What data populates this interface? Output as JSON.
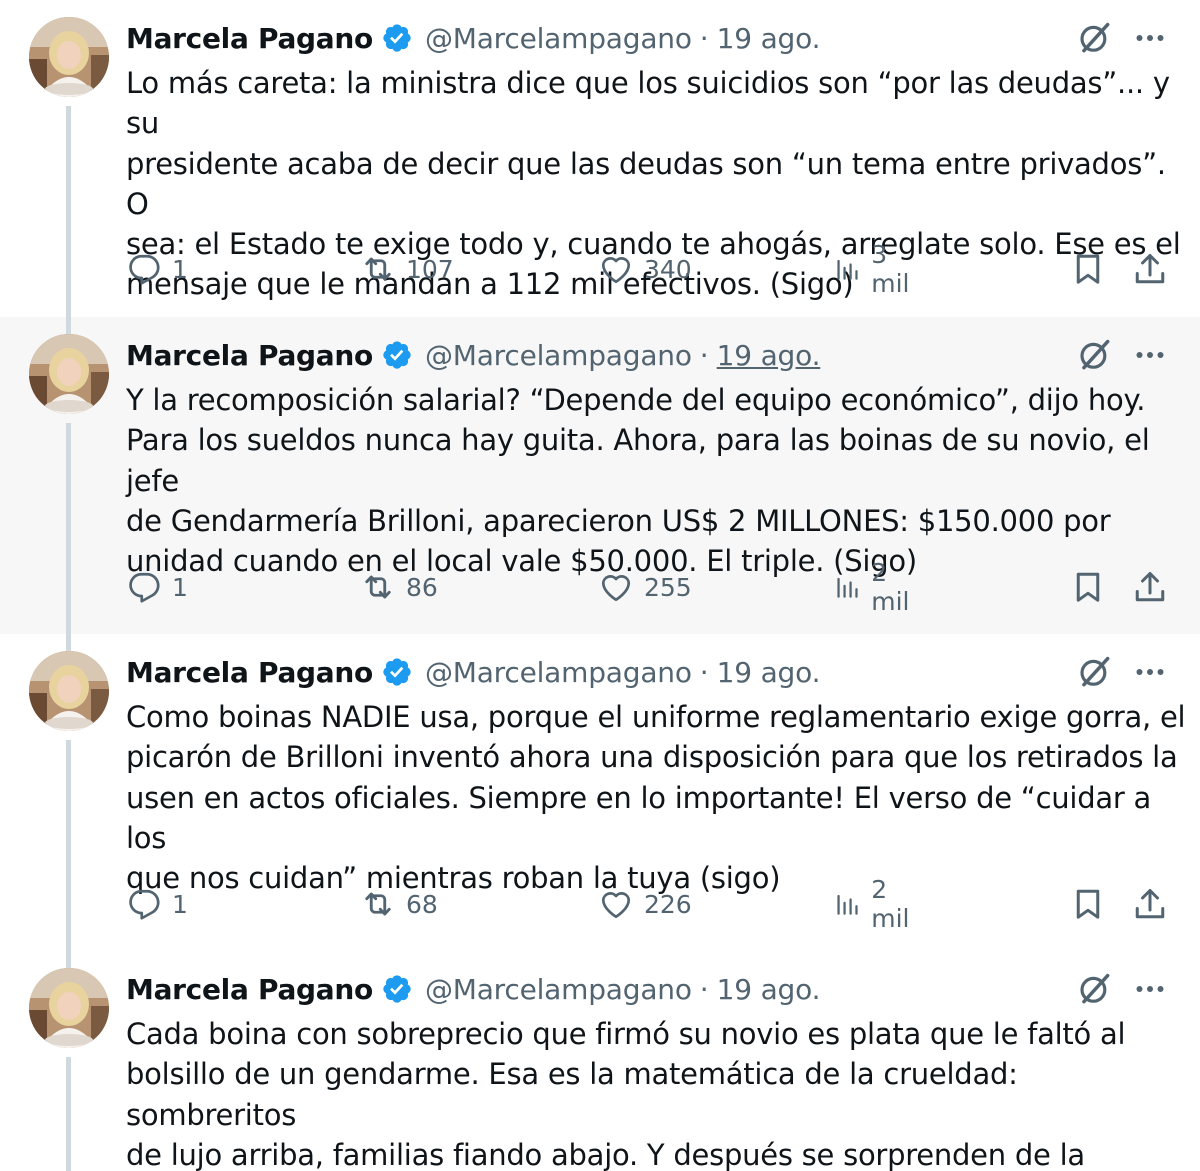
{
  "user": {
    "name": "Marcela Pagano",
    "handle": "@Marcelampagano",
    "separator": "·"
  },
  "colors": {
    "text": "#0f1419",
    "secondary": "#536471",
    "verified": "#1d9bf0",
    "hover_bg": "#f7f7f7",
    "thread_line": "#cfd9de"
  },
  "icons": {
    "grok": "grok-icon",
    "more": "more-icon",
    "reply": "reply-icon",
    "retweet": "retweet-icon",
    "like": "heart-icon",
    "views": "views-icon",
    "bookmark": "bookmark-icon",
    "share": "share-icon"
  },
  "tweets": [
    {
      "date": "19 ago.",
      "text": "Lo más careta: la ministra dice que los suicidios son “por las deudas”... y su\npresidente acaba de decir que las deudas son “un tema entre privados”. O\nsea: el Estado te exige todo y, cuando te ahogás, arreglate solo. Ese es el\nmensaje que le mandan a 112 mil efectivos. (Sigo)",
      "replies": "1",
      "retweets": "107",
      "likes": "340",
      "views": "3 mil"
    },
    {
      "date": "19 ago.",
      "text": "Y la recomposición salarial? “Depende del equipo económico”, dijo hoy.\nPara los sueldos nunca hay guita. Ahora, para las boinas de su novio, el jefe\nde Gendarmería Brilloni, aparecieron US$ 2 MILLONES: $150.000 por\nunidad cuando en el local vale $50.000. El triple. (Sigo)",
      "replies": "1",
      "retweets": "86",
      "likes": "255",
      "views": "2 mil"
    },
    {
      "date": "19 ago.",
      "text": "Como boinas NADIE usa, porque el uniforme reglamentario exige gorra, el\npicarón de Brilloni inventó ahora una disposición para que los retirados la\nusen en actos oficiales. Siempre en lo importante! El verso de “cuidar a los\nque nos cuidan” mientras roban la tuya (sigo)",
      "replies": "1",
      "retweets": "68",
      "likes": "226",
      "views": "2 mil"
    },
    {
      "date": "19 ago.",
      "text": "Cada boina con sobreprecio que firmó su novio es plata que le faltó al\nbolsillo de un gendarme. Esa es la matemática de la crueldad: sombreritos\nde lujo arriba, familias fiando abajo. Y después se sorprenden de la\ndesesperación en las filas. (Sigo)"
    }
  ]
}
